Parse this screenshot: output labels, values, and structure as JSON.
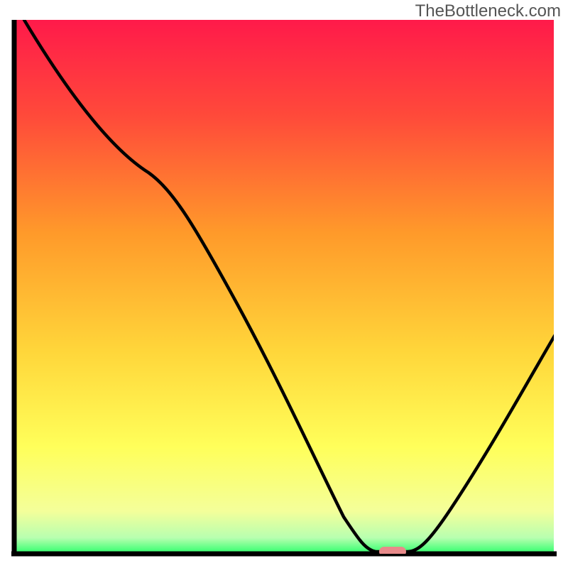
{
  "watermark": "TheBottleneck.com",
  "chart_data": {
    "type": "line",
    "title": "",
    "xlabel": "",
    "ylabel": "",
    "xlim": [
      0,
      100
    ],
    "ylim": [
      0,
      100
    ],
    "x": [
      0,
      25,
      60,
      67,
      72,
      100
    ],
    "values": [
      100,
      72,
      2,
      0,
      0,
      40
    ],
    "marker": {
      "x": 70,
      "y": 0,
      "color": "#e88a8a"
    },
    "background_gradient": {
      "top": "#ff1a4a",
      "mid_upper": "#ff8a2a",
      "mid": "#ffe63a",
      "lower": "#f8ff8a",
      "bottom": "#2aff6a"
    },
    "axis_color": "#000000",
    "line_color": "#000000"
  }
}
